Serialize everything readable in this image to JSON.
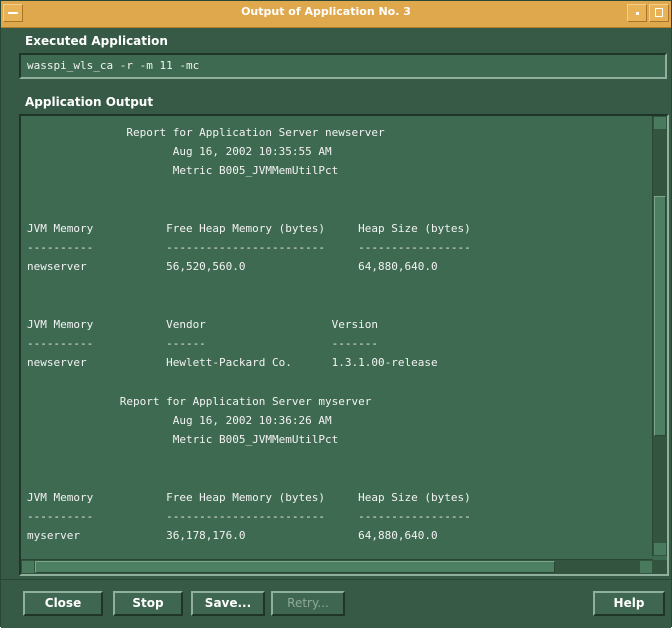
{
  "window": {
    "title": "Output of Application No. 3"
  },
  "executed": {
    "label": "Executed Application",
    "command": "wasspi_wls_ca -r -m 11 -mc"
  },
  "output": {
    "label": "Application Output",
    "lines": [
      "               Report for Application Server newserver",
      "                      Aug 16, 2002 10:35:55 AM",
      "                      Metric B005_JVMMemUtilPct",
      "",
      "",
      "JVM Memory           Free Heap Memory (bytes)     Heap Size (bytes)",
      "----------           ------------------------     -----------------",
      "newserver            56,520,560.0                 64,880,640.0",
      "",
      "",
      "JVM Memory           Vendor                   Version",
      "----------           ------                   -------",
      "newserver            Hewlett-Packard Co.      1.3.1.00-release",
      "",
      "              Report for Application Server myserver",
      "                      Aug 16, 2002 10:36:26 AM",
      "                      Metric B005_JVMMemUtilPct",
      "",
      "",
      "JVM Memory           Free Heap Memory (bytes)     Heap Size (bytes)",
      "----------           ------------------------     -----------------",
      "myserver             36,178,176.0                 64,880,640.0"
    ]
  },
  "buttons": {
    "close": "Close",
    "stop": "Stop",
    "save": "Save...",
    "retry": "Retry...",
    "help": "Help"
  },
  "icons": {
    "window_menu": "window-menu-icon",
    "minimize": "minimize-icon",
    "maximize": "maximize-icon"
  },
  "colors": {
    "title_bar": "#e0a84c",
    "window_bg": "#375a46",
    "field_bg": "#3f6a52"
  }
}
